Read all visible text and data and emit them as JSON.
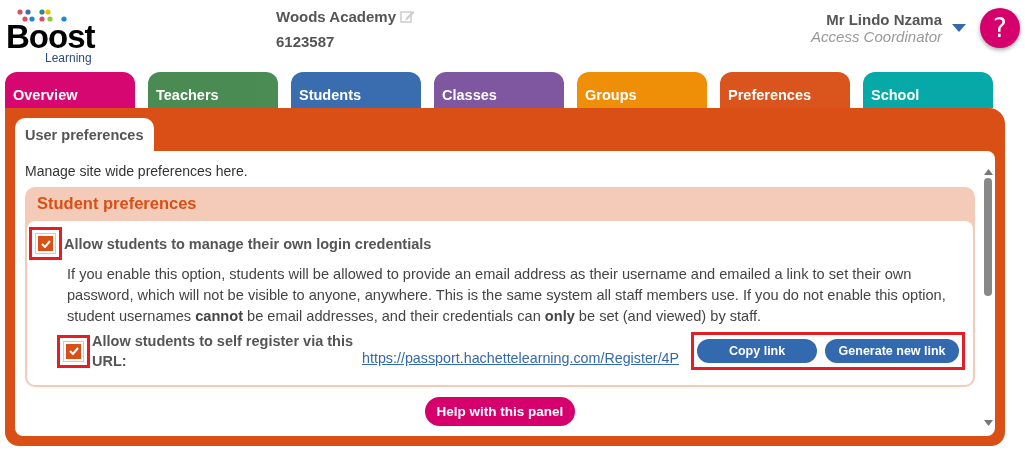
{
  "logo": {
    "name": "Boost",
    "subtitle": "Learning"
  },
  "school": {
    "name": "Woods Academy",
    "code": "6123587"
  },
  "user": {
    "name": "Mr Lindo Nzama",
    "role": "Access Coordinator"
  },
  "help_icon": "?",
  "tabs": [
    {
      "label": "Overview",
      "color": "#d6006d"
    },
    {
      "label": "Teachers",
      "color": "#45874e"
    },
    {
      "label": "Students",
      "color": "#3369ae"
    },
    {
      "label": "Classes",
      "color": "#7b519d"
    },
    {
      "label": "Groups",
      "color": "#ee8c00"
    },
    {
      "label": "Preferences",
      "color": "#d94f16"
    },
    {
      "label": "School",
      "color": "#00a6a6"
    }
  ],
  "subtabs": [
    {
      "label": "User preferences",
      "selected": true
    }
  ],
  "intro": "Manage site wide preferences here.",
  "section": {
    "title": "Student preferences",
    "options": [
      {
        "label": "Allow students to manage their own login credentials",
        "checked": true,
        "highlighted": true,
        "description": "If you enable this option, students will be allowed to provide an email address as their username and emailed a link to set their own password, which will not be visible to anyone, anywhere. This is the same system all staff members use. If you do not enable this option, student usernames **cannot** be email addresses, and their credentials can **only** be set (and viewed) by staff."
      },
      {
        "label": "Allow students to self register via this URL:",
        "checked": true,
        "highlighted": true,
        "url": "https://passport.hachettelearning.com/Register/4P",
        "buttons_highlighted": true,
        "buttons": [
          "Copy link",
          "Generate new link"
        ]
      }
    ]
  },
  "help_button": "Help with this panel"
}
